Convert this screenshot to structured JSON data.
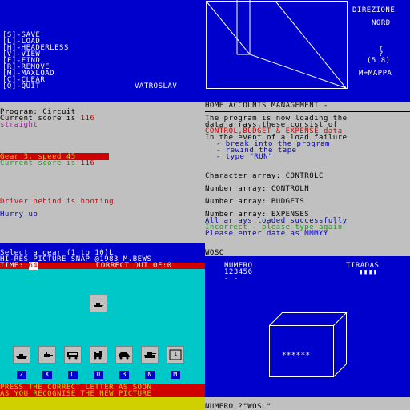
{
  "top_left": {
    "menu": [
      "[S]-SAVE",
      "[L]-LOAD",
      "[H]-HEADERLESS",
      "[V]-VIEW",
      "[F]-FIND",
      "[R]-REMOVE",
      "[M]-MAXLOAD",
      "[C]-CLEAR",
      "[Q]-QUIT"
    ],
    "author": "VATROSLAV"
  },
  "top_right": {
    "direction_title": "DIREZIONE",
    "direction_value": "NORD",
    "arrow": "↑",
    "question": "?",
    "range": "(5 8)",
    "map_hint": "M=MAPPA"
  },
  "racing": {
    "program": "Program: Circuit",
    "score_label": "Current score is ",
    "score_value": "116",
    "straight": "straight",
    "gear_line": "Gear 3, speed 45",
    "score2_label": "Current score is ",
    "score2_value": "116",
    "driver": "Driver behind is hooting",
    "hurry": "Hurry up"
  },
  "accounts": {
    "title": "HOME ACCOUNTS MANAGEMENT -",
    "l1": "The program is now loading the",
    "l2": "data arrays,these consist of",
    "l3": "CONTROL,BUDGET & EXPENSE data",
    "l4": "In the event of a load failure",
    "l5": " - break into the program",
    "l6": " - rewind the tape",
    "l7": " - type \"RUN\"",
    "char_array": "Character array: CONTROLC",
    "num_array1": "Number array: CONTROLN",
    "num_array2": "Number array: BUDGETS",
    "num_array3": "Number array: EXPENSES",
    "ok": "All arrays loaded successfully",
    "incorrect": "Incorrect - please type again",
    "date_prompt": "Please enter date as MMMYY",
    "input": "WOSC"
  },
  "snap": {
    "gear_prompt": "Select a gear (1 to 10)L",
    "header": "HI-RES PICTURE SNAP @1983 M.BEWS",
    "time_label": "TIME: ",
    "time_value": "64",
    "correct": "CORRECT OUT OF:0",
    "icons": [
      "ship-icon",
      "helicopter-icon",
      "bus-icon",
      "train-icon",
      "car-icon",
      "tank-icon",
      "clock-icon"
    ],
    "letters": [
      "Z",
      "X",
      "C",
      "U",
      "B",
      "N",
      "M"
    ],
    "footer1": "PRESS THE CORRECT LETTER AS SOON",
    "footer2": "AS YOU RECOGNISE THE NEW PICTURE"
  },
  "dice": {
    "numero_label": "NUMERO",
    "numero_value": "123456",
    "numero_marks": "- -",
    "tiradas_label": "TIRADAS",
    "tiradas_bars": "▮▮▮▮",
    "box_text": "******",
    "prompt": "NUMERO ?\"WOSL\""
  },
  "colors": {
    "blue": "#0000cd",
    "cyan": "#00c8c8",
    "grey": "#c0c0c0",
    "red": "#d00000",
    "yellow": "#d0d000"
  }
}
